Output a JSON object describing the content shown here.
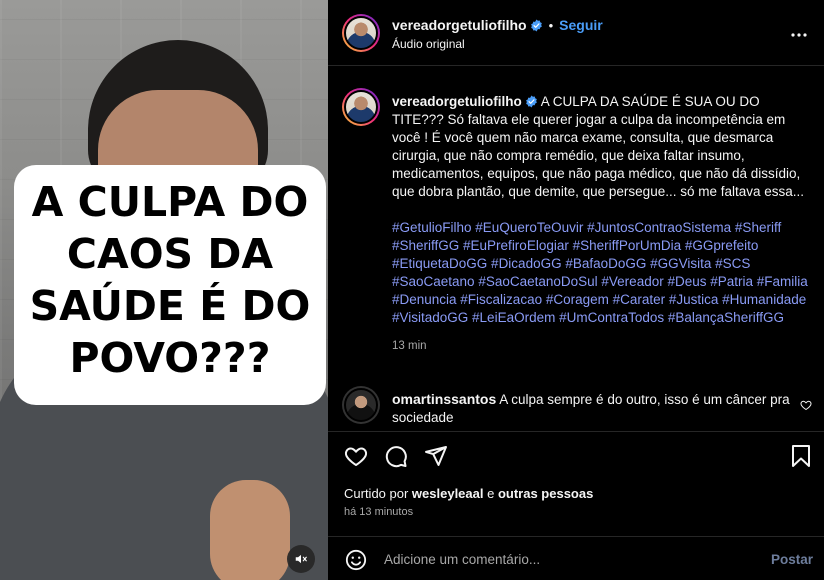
{
  "media": {
    "overlay_caption": "A CULPA DO CAOS DA SAÚDE É DO POVO???",
    "audio_icon": "speaker-muted-icon"
  },
  "header": {
    "username": "vereadorgetuliofilho",
    "dot": "•",
    "follow_label": "Seguir",
    "audio_label": "Áudio original",
    "more_icon": "more-options-icon"
  },
  "caption": {
    "username": "vereadorgetuliofilho",
    "text": " A CULPA DA SAÚDE É SUA OU DO TITE??? Só faltava ele querer jogar a culpa da incompetência em você ! É você quem não marca exame, consulta, que desmarca cirurgia, que não compra remédio, que deixa faltar insumo, medicamentos, equipos, que não paga médico, que não dá dissídio, que dobra plantão, que demite, que persegue... só me faltava essa...",
    "hashtags": "#GetulioFilho #EuQueroTeOuvir #JuntosContraoSistema #Sheriff #SheriffGG #EuPrefiroElogiar #SheriffPorUmDia #GGprefeito #EtiquetaDoGG #DicadoGG #BafaoDoGG #GGVisita #SCS #SaoCaetano #SaoCaetanoDoSul #Vereador #Deus #Patria #Familia #Denuncia #Fiscalizacao #Coragem #Carater #Justica #Humanidade #VisitadoGG #LeiEaOrdem #UmContraTodos #BalançaSheriffGG",
    "time": "13 min"
  },
  "comment": {
    "username": "omartinssantos",
    "text": " A culpa sempre é do outro, isso é um câncer pra sociedade"
  },
  "likes": {
    "prefix": "Curtido por ",
    "user": "wesleyleaal",
    "middle": " e ",
    "others": "outras pessoas"
  },
  "timestamp": "há 13 minutos",
  "composer": {
    "placeholder": "Adicione um comentário...",
    "post_label": "Postar"
  },
  "colors": {
    "link": "#4a9df8",
    "hashtag": "#8a9bf5",
    "post_disabled": "#6d7d9c"
  }
}
